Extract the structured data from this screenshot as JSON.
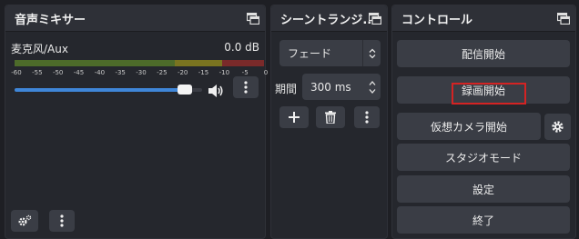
{
  "mixer": {
    "title": "音声ミキサー",
    "source_name": "麦克风/Aux",
    "source_level": "0.0 dB",
    "scale_ticks": [
      "-60",
      "-55",
      "-50",
      "-45",
      "-40",
      "-35",
      "-30",
      "-25",
      "-20",
      "-15",
      "-10",
      "-5",
      "0"
    ],
    "volume_fraction": 0.94
  },
  "transition": {
    "title": "シーントランジ...",
    "selected": "フェード",
    "duration_label": "期間",
    "duration_value": "300 ms"
  },
  "controls": {
    "title": "コントロール",
    "start_streaming": "配信開始",
    "start_recording": "録画開始",
    "start_virtual_camera": "仮想カメラ開始",
    "studio_mode": "スタジオモード",
    "settings": "設定",
    "exit": "終了"
  },
  "colors": {
    "accent": "#3f86d8",
    "highlight": "#d42323",
    "meter_green": "#4d6b2a",
    "meter_yellow": "#7a7420",
    "meter_red": "#7a2a2a"
  },
  "icons": {
    "float": "float-icon",
    "speaker": "speaker-icon",
    "kebab": "kebab-icon",
    "gear": "gear-icon",
    "plus": "plus-icon",
    "trash": "trash-icon",
    "chevron": "chevron-updown-icon"
  }
}
